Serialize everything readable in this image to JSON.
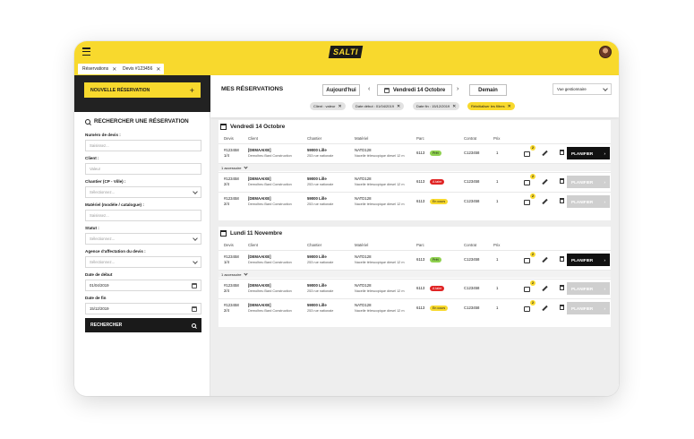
{
  "topbar": {
    "logo_text": "SALTI"
  },
  "tabs": [
    {
      "label": "Réservations"
    },
    {
      "label": "Devis #123456"
    }
  ],
  "sidebar": {
    "new_button": "NOUVELLE RÉSERVATION",
    "search_title": "RECHERCHER UNE RÉSERVATION",
    "fields": [
      {
        "label": "Numéro de devis :",
        "placeholder": "Saisissez...",
        "type": "text"
      },
      {
        "label": "Client :",
        "placeholder": "Valeur",
        "type": "text"
      },
      {
        "label": "Chantier (CP - Ville) :",
        "placeholder": "Sélectionnez...",
        "type": "select"
      },
      {
        "label": "Matériel (modèle / catalogue) :",
        "placeholder": "Saisissez...",
        "type": "text"
      },
      {
        "label": "Statut :",
        "placeholder": "Sélectionnez...",
        "type": "select"
      },
      {
        "label": "Agence d'affectation du devis :",
        "placeholder": "Sélectionnez...",
        "type": "select"
      },
      {
        "label": "Date de début",
        "value": "01/04/2019",
        "type": "date"
      },
      {
        "label": "Date de fin",
        "value": "15/12/2019",
        "type": "date"
      }
    ],
    "search_button": "RECHERCHER"
  },
  "header": {
    "title": "MES RÉSERVATIONS",
    "today_button": "Aujourd'hui",
    "current_date": "Vendredi 14 Octobre",
    "next_day_button": "Demain",
    "view_select": "Vue gestionnaire",
    "filters": [
      {
        "label": "Client : valeur"
      },
      {
        "label": "Date début : 01/04/2019"
      },
      {
        "label": "Date fin : 15/12/2019"
      },
      {
        "label": "Réinitialiser les filtres"
      }
    ]
  },
  "columns": [
    "Devis",
    "Client",
    "Chantier",
    "Matériel",
    "Parc",
    "Contrat",
    "Prix"
  ],
  "accessory_label": "1 accessoire",
  "colors": {
    "yellow": "#f8d92d",
    "dark": "#1a1a1a",
    "green": "#8fd14f",
    "red": "#e02424"
  },
  "sections": [
    {
      "title": "Vendredi 14 Octobre",
      "rows": [
        {
          "devis": "#123458",
          "devis_sub": "1/4",
          "client": "[DEMAAIXE]",
          "client_sub": "Demolheu Bard Construction",
          "chantier": "59000 Lille",
          "chantier_sub": "253 rue nationale",
          "materiel": "NATD128",
          "materiel_sub": "Nacelle télescopique diesel 12 m",
          "parc": "6113",
          "status": "Prêt",
          "status_color": "green",
          "contrat": "C123458",
          "prix": "1",
          "notif": "2",
          "plan_label": "PLANIFIER",
          "plan_active": true
        },
        {
          "devis": "#123458",
          "devis_sub": "2/4",
          "client": "[DEMAAIXE]",
          "client_sub": "Demolheu Bard Construction",
          "chantier": "59000 Lille",
          "chantier_sub": "253 rue nationale",
          "materiel": "NATD128",
          "materiel_sub": "Nacelle télescopique diesel 12 m",
          "parc": "6113",
          "status": "A taire",
          "status_color": "red",
          "contrat": "C123458",
          "prix": "1",
          "notif": "2",
          "plan_label": "PLANIFIER",
          "plan_active": false
        },
        {
          "devis": "#123458",
          "devis_sub": "2/4",
          "client": "[DEMAAIXE]",
          "client_sub": "Demolheu Bard Construction",
          "chantier": "59000 Lille",
          "chantier_sub": "253 rue nationale",
          "materiel": "NATD128",
          "materiel_sub": "Nacelle télescopique diesel 12 m",
          "parc": "6113",
          "status": "En cours",
          "status_color": "yellow",
          "contrat": "C123458",
          "prix": "1",
          "notif": "2",
          "plan_label": "PLANIFIER",
          "plan_active": false
        }
      ]
    },
    {
      "title": "Lundi 11 Novembre",
      "rows": [
        {
          "devis": "#123458",
          "devis_sub": "1/4",
          "client": "[DEMAAIXE]",
          "client_sub": "Demolheu Bard Construction",
          "chantier": "59000 Lille",
          "chantier_sub": "253 rue nationale",
          "materiel": "NATD128",
          "materiel_sub": "Nacelle télescopique diesel 12 m",
          "parc": "6113",
          "status": "Prêt",
          "status_color": "green",
          "contrat": "C123458",
          "prix": "1",
          "notif": "2",
          "plan_label": "PLANIFIER",
          "plan_active": true
        },
        {
          "devis": "#123458",
          "devis_sub": "2/4",
          "client": "[DEMAAIXE]",
          "client_sub": "Demolheu Bard Construction",
          "chantier": "59000 Lille",
          "chantier_sub": "253 rue nationale",
          "materiel": "NATD128",
          "materiel_sub": "Nacelle télescopique diesel 12 m",
          "parc": "6113",
          "status": "A taire",
          "status_color": "red",
          "contrat": "C123458",
          "prix": "1",
          "notif": "2",
          "plan_label": "PLANIFIER",
          "plan_active": false
        },
        {
          "devis": "#123458",
          "devis_sub": "2/4",
          "client": "[DEMAAIXE]",
          "client_sub": "Demolheu Bard Construction",
          "chantier": "59000 Lille",
          "chantier_sub": "253 rue nationale",
          "materiel": "NATD128",
          "materiel_sub": "Nacelle télescopique diesel 12 m",
          "parc": "6113",
          "status": "En cours",
          "status_color": "yellow",
          "contrat": "C123458",
          "prix": "1",
          "notif": "2",
          "plan_label": "PLANIFIER",
          "plan_active": false
        }
      ]
    }
  ]
}
